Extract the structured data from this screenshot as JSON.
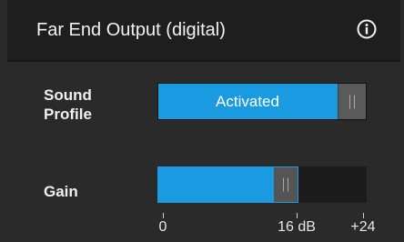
{
  "panel": {
    "title": "Far End Output (digital)",
    "info_icon": "info-circle-icon"
  },
  "sound_profile": {
    "label": "Sound Profile",
    "state_text": "Activated",
    "active": true
  },
  "gain": {
    "label": "Gain",
    "min": 0,
    "max": 24,
    "value": 16,
    "ticks": [
      {
        "value": 0,
        "label": "0"
      },
      {
        "value": 16,
        "label": "16 dB"
      },
      {
        "value": 24,
        "label": "+24"
      }
    ]
  },
  "colors": {
    "accent": "#1a9ae0",
    "background": "#2a2a2a",
    "header": "#1e1e1e",
    "thumb": "#555555"
  }
}
